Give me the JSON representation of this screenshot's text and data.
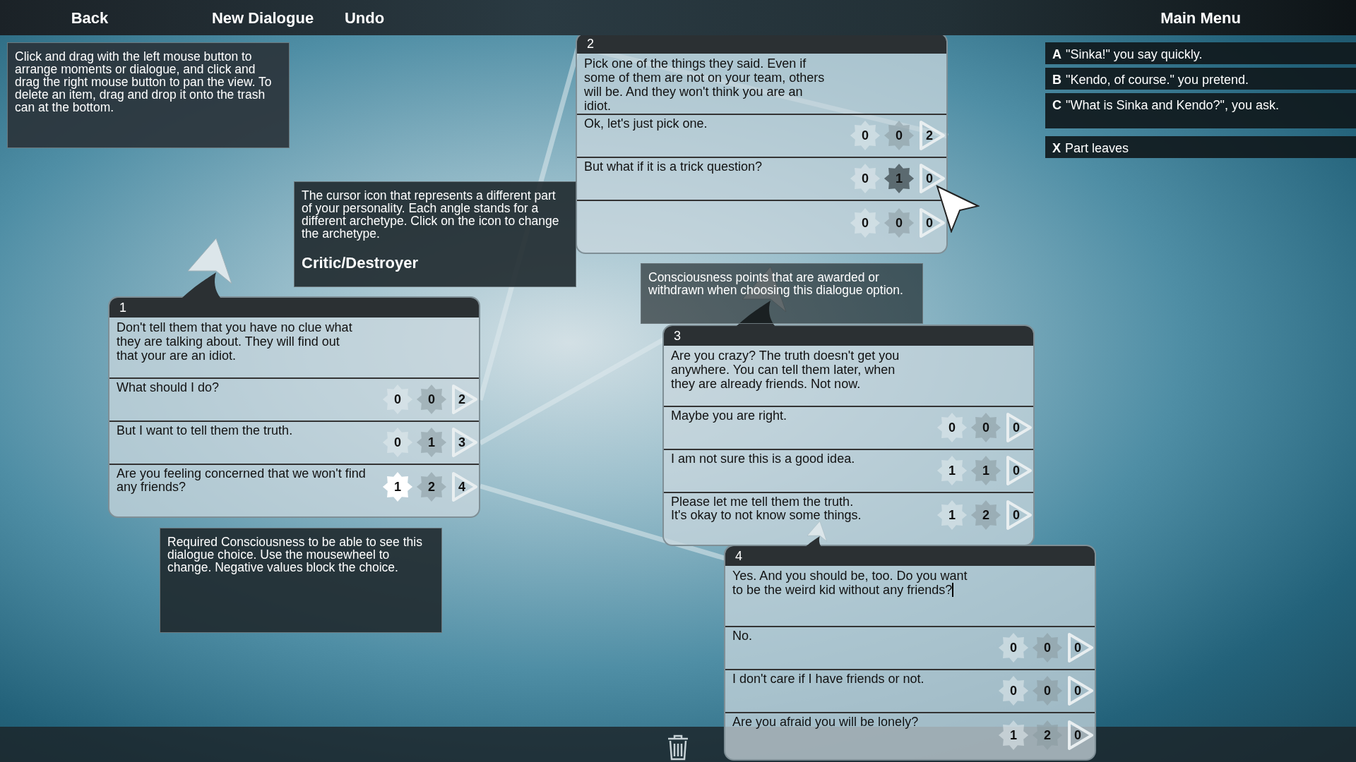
{
  "top_bar": {
    "left_buttons": [
      "Back",
      "New Dialogue",
      "Undo"
    ],
    "right_button": "Main Menu"
  },
  "help_tips": [
    {
      "kind": "plain",
      "text": "Click and drag with the left mouse button to arrange moments or dialogue, and click and drag the right mouse button to pan the view. To delete an item, drag and drop it onto the trash can at the bottom."
    },
    {
      "kind": "archetype",
      "text": "The cursor icon that represents a different part of your personality. Each angle stands for a different archetype. Click on the icon to change the archetype.",
      "title": "Critic/Destroyer"
    },
    {
      "kind": "plain",
      "text": "Required Consciousness to be able to see this dialogue choice. Use the mousewheel to change. Negative values block the choice."
    },
    {
      "kind": "overlay",
      "text": "Consciousness points that are awarded or withdrawn when choosing this dialogue option."
    }
  ],
  "nodes": [
    {
      "number": "1",
      "editing": false,
      "prompt": "Don't tell them that you have no clue what they are talking about. They will find out that your are an idiot.",
      "options": [
        {
          "text": "What should I do?",
          "required": "0",
          "points": "0",
          "target": "2",
          "required_highlighted": false,
          "points_highlighted": false
        },
        {
          "text": "But I want to tell them the truth.",
          "required": "0",
          "points": "1",
          "target": "3",
          "required_highlighted": false,
          "points_highlighted": false
        },
        {
          "text": "Are you feeling concerned that we won't find any friends?",
          "required": "1",
          "points": "2",
          "target": "4",
          "required_highlighted": true,
          "points_highlighted": false
        }
      ]
    },
    {
      "number": "2",
      "editing": false,
      "prompt": "Pick one of the things they said. Even if some of them are not on your team, others  will be. And they won't think you are an idiot.",
      "options": [
        {
          "text": "Ok, let's just pick one.",
          "required": "0",
          "points": "0",
          "target": "2",
          "required_highlighted": false,
          "points_highlighted": false
        },
        {
          "text": "But what if it is a trick question?",
          "required": "0",
          "points": "1",
          "target": "0",
          "required_highlighted": false,
          "points_highlighted": true
        },
        {
          "required": "0",
          "points": "0",
          "target": "0",
          "required_highlighted": false,
          "points_highlighted": false
        }
      ]
    },
    {
      "number": "3",
      "editing": false,
      "prompt": "Are you crazy? The truth doesn't get you anywhere. You can tell them later, when they are already friends. Not now.",
      "options": [
        {
          "text": "Maybe you are right.",
          "required": "0",
          "points": "0",
          "target": "0",
          "required_highlighted": false,
          "points_highlighted": false
        },
        {
          "text": "I am not sure this is a good idea.",
          "required": "1",
          "points": "1",
          "target": "0",
          "required_highlighted": false,
          "points_highlighted": false
        },
        {
          "text": "Please let me tell them the truth.\nIt's okay to not know some things.",
          "required": "1",
          "points": "2",
          "target": "0",
          "required_highlighted": false,
          "points_highlighted": false
        }
      ]
    },
    {
      "number": "4",
      "editing": true,
      "prompt": "Yes. And you should be, too. Do you want to be the weird kid without any friends?",
      "options": [
        {
          "text": "No.",
          "required": "0",
          "points": "0",
          "target": "0",
          "required_highlighted": false,
          "points_highlighted": false
        },
        {
          "text": "I don't care if I have friends or not.",
          "required": "0",
          "points": "0",
          "target": "0",
          "required_highlighted": false,
          "points_highlighted": false
        },
        {
          "text": "Are you afraid you will be lonely?",
          "required": "1",
          "points": "2",
          "target": "0",
          "required_highlighted": false,
          "points_highlighted": false
        }
      ]
    }
  ],
  "preview_choices": [
    {
      "key": "A",
      "text": "\"Sinka!\" you say quickly."
    },
    {
      "key": "B",
      "text": "\"Kendo, of course.\" you pretend."
    },
    {
      "key": "C",
      "text": "\"What is Sinka and Kendo?\", you ask."
    },
    {
      "key": "X",
      "text": "Part leaves"
    }
  ]
}
